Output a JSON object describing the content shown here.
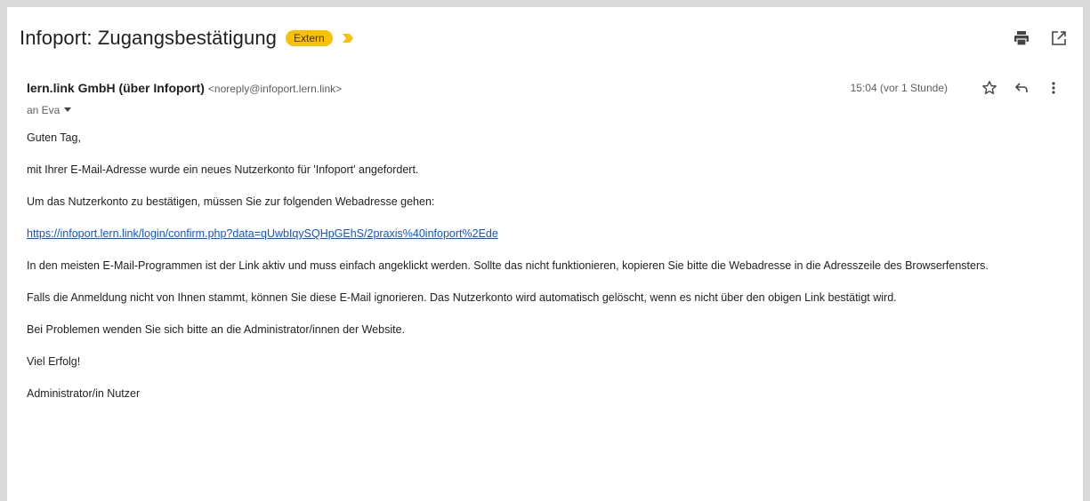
{
  "email": {
    "subject": "Infoport: Zugangsbestätigung",
    "label_badge": "Extern",
    "sender_name": "lern.link GmbH (über Infoport)",
    "sender_email": "<noreply@infoport.lern.link>",
    "recipient": "an Eva",
    "timestamp": "15:04 (vor 1 Stunde)",
    "body": {
      "greeting": "Guten Tag,",
      "p1": "mit Ihrer E-Mail-Adresse wurde ein neues Nutzerkonto für 'Infoport' angefordert.",
      "p2": "Um das Nutzerkonto zu bestätigen, müssen Sie zur folgenden Webadresse gehen:",
      "link": "https://infoport.lern.link/login/confirm.php?data=qUwbIqySQHpGEhS/2praxis%40infoport%2Ede",
      "p3": "In den meisten E-Mail-Programmen ist der Link aktiv und muss einfach angeklickt werden. Sollte das nicht funktionieren, kopieren Sie bitte die Webadresse in die Adresszeile des Browserfensters.",
      "p4": "Falls die Anmeldung nicht von Ihnen stammt, können Sie diese E-Mail ignorieren. Das Nutzerkonto wird automatisch gelöscht, wenn es nicht über den obigen Link bestätigt wird.",
      "p5": "Bei Problemen wenden Sie sich bitte an die Administrator/innen der Website.",
      "closing": "Viel Erfolg!",
      "signature": "Administrator/in Nutzer"
    }
  },
  "icons": {
    "print": "print-icon",
    "open_new_window": "open-in-new-window-icon",
    "star": "star-icon",
    "reply": "reply-icon",
    "more": "more-vert-icon",
    "importance": "importance-marker-icon",
    "dropdown": "caret-down-icon"
  },
  "colors": {
    "badge_bg": "#f7c204",
    "importance_marker": "#f7c204",
    "link": "#1155cc",
    "frame": "#dadada"
  }
}
